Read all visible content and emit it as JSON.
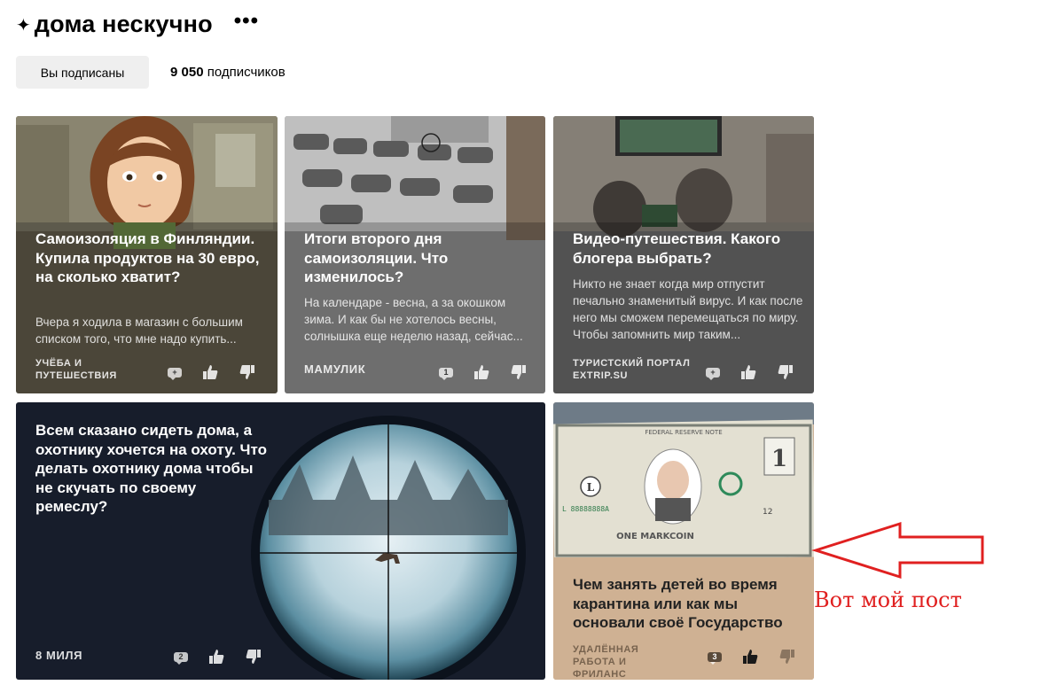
{
  "channel": {
    "title": "дома нескучно",
    "more_icon": "•••",
    "subscribe_label": "Вы подписаны",
    "subscribers_count": "9 050",
    "subscribers_label": "подписчиков"
  },
  "cards": [
    {
      "title": "Самоизоляция в Финляндии. Купила продуктов на 30 евро, на сколько хватит?",
      "snippet": "Вчера я ходила в магазин с большим списком того, что мне надо купить...",
      "source": "УЧЁБА И ПУТЕШЕСТВИЯ",
      "comments": "+"
    },
    {
      "title": "Итоги второго дня самоизоляции. Что изменилось?",
      "snippet": "На календаре - весна, а за окошком зима. И как бы не хотелось весны, солнышка еще неделю назад, сейчас...",
      "source": "МАМУЛИК",
      "comments": "1"
    },
    {
      "title": "Видео-путешествия. Какого блогера выбрать?",
      "snippet": "Никто не знает когда мир отпустит печально знаменитый вирус. И как после него мы сможем перемещаться по миру. Чтобы запомнить мир таким...",
      "source": "ТУРИСТСКИЙ ПОРТАЛ EXTRIP.SU",
      "comments": "+"
    },
    {
      "title": "Всем сказано сидеть дома, а охотнику хочется на охоту. Что делать охотнику дома чтобы не скучать по своему ремеслу?",
      "source": "8 МИЛЯ",
      "comments": "2"
    },
    {
      "title": "Чем занять детей во время карантина или как мы основали своё Государство",
      "source": "УДАЛЁННАЯ РАБОТА И ФРИЛАНС",
      "comments": "3",
      "banknote": {
        "top_text": "FEDERAL RESERVE NOTE",
        "number": "L 88888888A",
        "denomination": "1",
        "letter": "L",
        "name": "ONE MARKCOIN",
        "small": "12"
      }
    }
  ],
  "annotation": {
    "text": "Вот мой пост",
    "color": "#e02020"
  }
}
